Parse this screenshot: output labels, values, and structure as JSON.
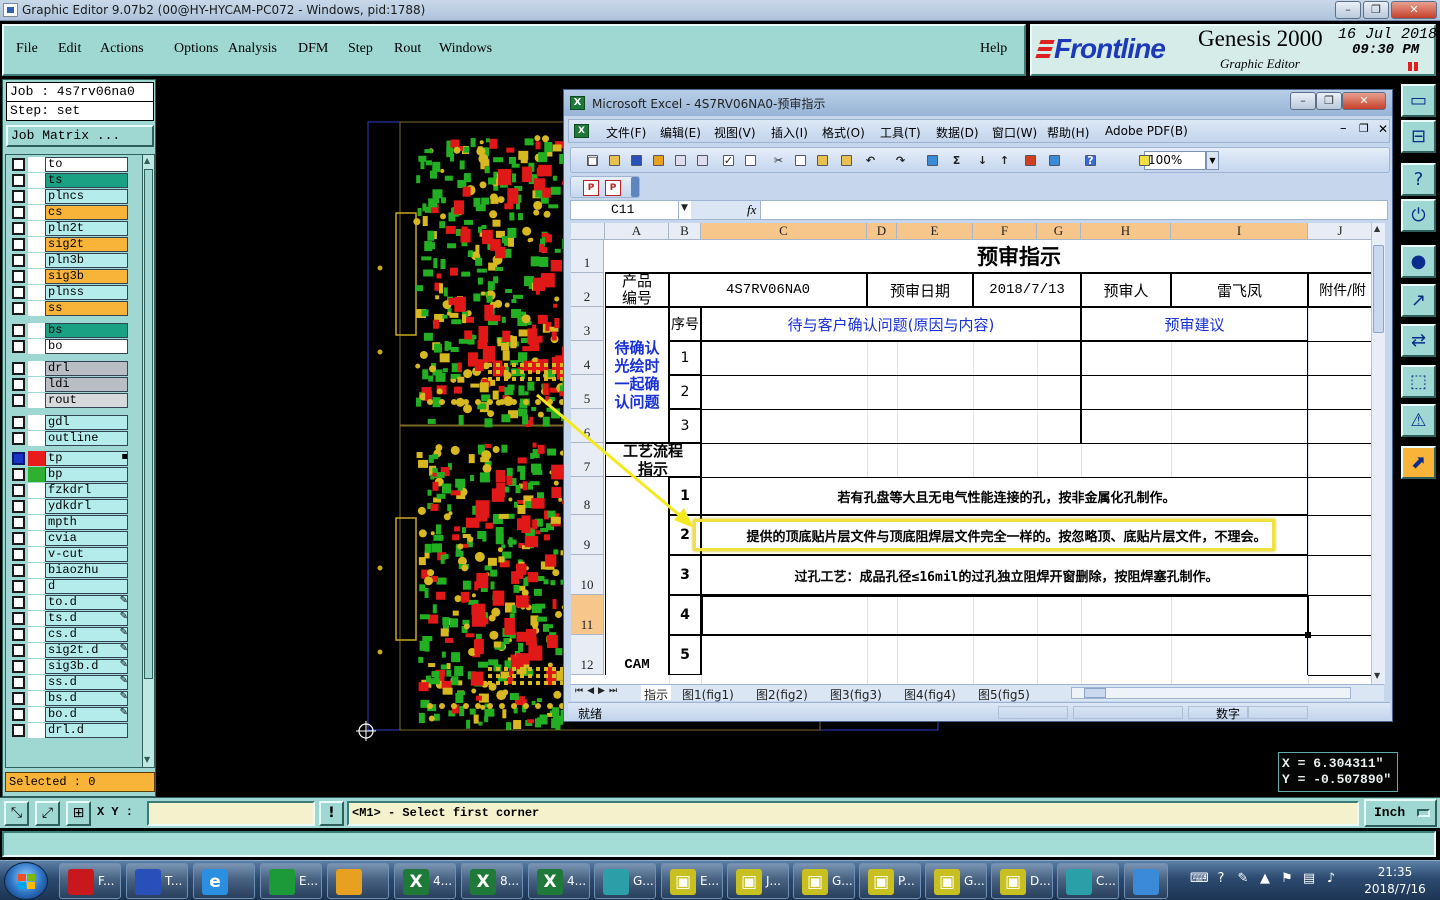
{
  "app": {
    "window_title": "Graphic Editor 9.07b2 (00@HY-HYCAM-PC072 - Windows, pid:1788)",
    "menu": [
      "File",
      "Edit",
      "Actions",
      "Options",
      "Analysis",
      "DFM",
      "Step",
      "Rout",
      "Windows"
    ],
    "help": "Help"
  },
  "logo": {
    "brand": "Frontline",
    "product": "Genesis 2000",
    "subtitle": "Graphic Editor",
    "date": "16 Jul 2018",
    "time": "09:30 PM"
  },
  "job_panel": {
    "job": "Job : 4s7rv06na0",
    "step": "Step: set",
    "job_matrix": "Job Matrix ...",
    "selected": "Selected : 0",
    "layers": [
      {
        "name": "to",
        "color": "#ffffff",
        "swatch": "#ffffff"
      },
      {
        "name": "ts",
        "color": "#1aa083",
        "swatch": "#ffffff"
      },
      {
        "name": "plncs",
        "color": "#b4ecec",
        "swatch": "#ffffff"
      },
      {
        "name": "cs",
        "color": "#f8b438",
        "swatch": "#ffffff"
      },
      {
        "name": "pln2t",
        "color": "#b4ecec",
        "swatch": "#ffffff"
      },
      {
        "name": "sig2t",
        "color": "#f8b438",
        "swatch": "#ffffff"
      },
      {
        "name": "pln3b",
        "color": "#b4ecec",
        "swatch": "#ffffff"
      },
      {
        "name": "sig3b",
        "color": "#f8b438",
        "swatch": "#ffffff"
      },
      {
        "name": "plnss",
        "color": "#b4ecec",
        "swatch": "#ffffff"
      },
      {
        "name": "ss",
        "color": "#f8b438",
        "swatch": "#ffffff"
      },
      {
        "name": "bs",
        "color": "#1aa083",
        "swatch": "#ffffff"
      },
      {
        "name": "bo",
        "color": "#ffffff",
        "swatch": "#ffffff"
      },
      {
        "name": "drl",
        "color": "#b9bec4",
        "swatch": "#ffffff"
      },
      {
        "name": "ldi",
        "color": "#b9bec4",
        "swatch": "#ffffff"
      },
      {
        "name": "rout",
        "color": "#d7dadd",
        "swatch": "#ffffff"
      },
      {
        "name": "gdl",
        "color": "#b4ecec",
        "swatch": "#ffffff"
      },
      {
        "name": "outline",
        "color": "#b4ecec",
        "swatch": "#ffffff"
      },
      {
        "name": "tp",
        "color": "#b4ecec",
        "swatch": "#e81c1c",
        "state": "work",
        "edit": "▪"
      },
      {
        "name": "bp",
        "color": "#b4ecec",
        "swatch": "#30b030"
      },
      {
        "name": "fzkdrl",
        "color": "#b4ecec",
        "swatch": "#ffffff"
      },
      {
        "name": "ydkdrl",
        "color": "#b4ecec",
        "swatch": "#ffffff"
      },
      {
        "name": "mpth",
        "color": "#b4ecec",
        "swatch": "#ffffff"
      },
      {
        "name": "cvia",
        "color": "#b4ecec",
        "swatch": "#ffffff"
      },
      {
        "name": "v-cut",
        "color": "#b4ecec",
        "swatch": "#ffffff"
      },
      {
        "name": "biaozhu",
        "color": "#b4ecec",
        "swatch": "#ffffff"
      },
      {
        "name": "d",
        "color": "#b4ecec",
        "swatch": "#ffffff"
      },
      {
        "name": "to.d",
        "color": "#b4ecec",
        "swatch": "#ffffff",
        "edit": "✎"
      },
      {
        "name": "ts.d",
        "color": "#b4ecec",
        "swatch": "#ffffff",
        "edit": "✎"
      },
      {
        "name": "cs.d",
        "color": "#b4ecec",
        "swatch": "#ffffff",
        "edit": "✎"
      },
      {
        "name": "sig2t.d",
        "color": "#b4ecec",
        "swatch": "#ffffff",
        "edit": "✎"
      },
      {
        "name": "sig3b.d",
        "color": "#b4ecec",
        "swatch": "#ffffff",
        "edit": "✎"
      },
      {
        "name": "ss.d",
        "color": "#b4ecec",
        "swatch": "#ffffff",
        "edit": "✎"
      },
      {
        "name": "bs.d",
        "color": "#b4ecec",
        "swatch": "#ffffff",
        "edit": "✎"
      },
      {
        "name": "bo.d",
        "color": "#b4ecec",
        "swatch": "#ffffff",
        "edit": "✎"
      },
      {
        "name": "drl.d",
        "color": "#b4ecec",
        "swatch": "#ffffff"
      }
    ]
  },
  "pcb_view": {
    "x_readout": "X =  6.304311\"",
    "y_readout": "Y = -0.507890\""
  },
  "excel": {
    "title": "Microsoft Excel - 4S7RV06NA0-预审指示",
    "menu": [
      "文件(F)",
      "编辑(E)",
      "视图(V)",
      "插入(I)",
      "格式(O)",
      "工具(T)",
      "数据(D)",
      "窗口(W)",
      "帮助(H)",
      "Adobe PDF(B)"
    ],
    "toolbar_icons": [
      "new-icon",
      "open-icon",
      "save-icon",
      "permission-icon",
      "print-icon",
      "print-preview-icon",
      "spelling-icon",
      "research-icon",
      "cut-icon",
      "copy-icon",
      "paste-icon",
      "format-painter-icon",
      "undo-icon",
      "redo-icon",
      "hyperlink-icon",
      "autosum-icon",
      "sort-ascending-icon",
      "sort-descending-icon",
      "chart-wizard-icon",
      "drawing-icon",
      "help-icon",
      "fill-color-icon"
    ],
    "zoom": "100%",
    "fx": "fx",
    "name_box": "C11",
    "columns": [
      "A",
      "B",
      "C",
      "D",
      "E",
      "F",
      "G",
      "H",
      "I",
      "J"
    ],
    "rows": [
      "1",
      "2",
      "3",
      "4",
      "5",
      "6",
      "7",
      "8",
      "9",
      "10",
      "11",
      "12"
    ],
    "cells": {
      "title": "预审指示",
      "a2": "产品\n编号",
      "c2": "4S7RV06NA0",
      "d2": "预审日期",
      "f2": "2018/7/13",
      "h2": "预审人",
      "i2": "雷飞凤",
      "j2": "附件/附",
      "b3": "序号",
      "c3": "待与客户确认问题(原因与内容)",
      "h3": "预审建议",
      "a3": "待确认\n光绘时\n一起确\n认问题",
      "b4": "1",
      "b5": "2",
      "b6": "3",
      "a7": "工艺流程\n指示",
      "b8": "1",
      "c8": "若有孔盘等大且无电气性能连接的孔，按非金属化孔制作。",
      "b9": "2",
      "c9": "提供的顶底贴片层文件与顶底阻焊层文件完全一样的。按忽略顶、底贴片层文件，不理会。",
      "b10": "3",
      "c10": "过孔工艺：成品孔径≤16mil的过孔独立阻焊开窗删除，按阻焊塞孔制作。",
      "b11": "4",
      "b12": "5",
      "a12": "CAM"
    },
    "sheet_tabs": [
      "指示",
      "图1(fig1)",
      "图2(fig2)",
      "图3(fig3)",
      "图4(fig4)",
      "图5(fig5)"
    ],
    "status_left": "就绪",
    "status_right": "数字"
  },
  "command_bar": {
    "xy_label": "X Y :",
    "xy_value": "",
    "prompt": "<M1> - Select first corner",
    "units": "Inch"
  },
  "right_toolbar": [
    "view-window-icon",
    "snap-icon",
    "query-icon",
    "feature-filter-icon",
    "pad-icon",
    "route-icon",
    "compare-icon",
    "layer-group-icon",
    "measure-icon",
    "selection-tool-icon"
  ],
  "taskbar": {
    "items": [
      {
        "label": "F...",
        "icon": "genesis-icon",
        "color": "#c8181c"
      },
      {
        "label": "T...",
        "icon": "floppy-save-icon",
        "color": "#2850b8"
      },
      {
        "label": "",
        "icon": "internet-explorer-icon",
        "color": "#2a8fe0"
      },
      {
        "label": "E...",
        "icon": "frontline-icon",
        "color": "#1c9a3a"
      },
      {
        "label": "",
        "icon": "shell-icon",
        "color": "#e8a020"
      },
      {
        "label": "4...",
        "icon": "excel-icon",
        "color": "#1f7a3a"
      },
      {
        "label": "8...",
        "icon": "excel-icon",
        "color": "#1f7a3a"
      },
      {
        "label": "4...",
        "icon": "excel-icon",
        "color": "#1f7a3a"
      },
      {
        "label": "G...",
        "icon": "graphic-editor-icon",
        "color": "#2a9fa8"
      },
      {
        "label": "E...",
        "icon": "window-icon",
        "color": "#c8c020"
      },
      {
        "label": "J...",
        "icon": "window-icon",
        "color": "#c8c020"
      },
      {
        "label": "G...",
        "icon": "window-icon",
        "color": "#c8c020"
      },
      {
        "label": "P...",
        "icon": "window-icon",
        "color": "#c8c020"
      },
      {
        "label": "G...",
        "icon": "window-icon",
        "color": "#c8c020"
      },
      {
        "label": "D...",
        "icon": "window-icon",
        "color": "#c8c020"
      },
      {
        "label": "C...",
        "icon": "graphic-editor-icon",
        "color": "#2a9fa8"
      },
      {
        "label": "",
        "icon": "feather-icon",
        "color": "#3a8ad8"
      }
    ],
    "tray": [
      "keyboard-icon",
      "help-tray-icon",
      "pen-icon",
      "chevron-up-icon",
      "flag-icon",
      "network-icon",
      "volume-icon"
    ],
    "time": "21:35",
    "date": "2018/7/16"
  }
}
